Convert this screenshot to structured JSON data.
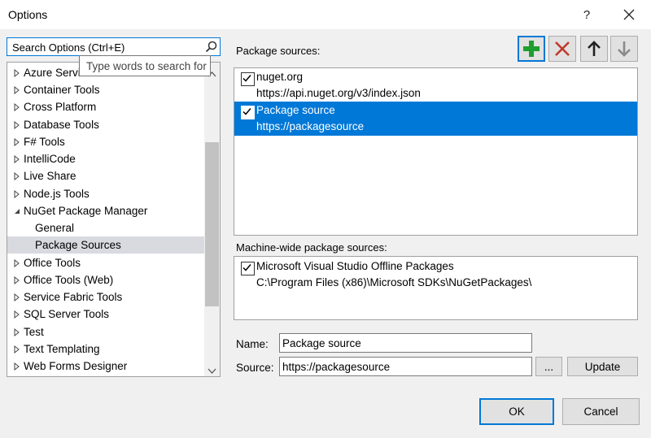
{
  "window": {
    "title": "Options",
    "help": "?",
    "close": "✕"
  },
  "search": {
    "value": "Search Options (Ctrl+E)",
    "tooltip": "Type words to search for"
  },
  "tree": {
    "items": [
      {
        "label": "Azure Servi"
      },
      {
        "label": "Container Tools"
      },
      {
        "label": "Cross Platform"
      },
      {
        "label": "Database Tools"
      },
      {
        "label": "F# Tools"
      },
      {
        "label": "IntelliCode"
      },
      {
        "label": "Live Share"
      },
      {
        "label": "Node.js Tools"
      },
      {
        "label": "NuGet Package Manager"
      },
      {
        "label": "General"
      },
      {
        "label": "Package Sources"
      },
      {
        "label": "Office Tools"
      },
      {
        "label": "Office Tools (Web)"
      },
      {
        "label": "Service Fabric Tools"
      },
      {
        "label": "SQL Server Tools"
      },
      {
        "label": "Test"
      },
      {
        "label": "Text Templating"
      },
      {
        "label": "Web Forms Designer"
      }
    ]
  },
  "package_sources": {
    "label": "Package sources:",
    "entries": [
      {
        "name": "nuget.org",
        "url": "https://api.nuget.org/v3/index.json",
        "checked": true
      },
      {
        "name": "Package source",
        "url": "https://packagesource",
        "checked": true
      }
    ]
  },
  "machine_wide": {
    "label": "Machine-wide package sources:",
    "entries": [
      {
        "name": "Microsoft Visual Studio Offline Packages",
        "path": "C:\\Program Files (x86)\\Microsoft SDKs\\NuGetPackages\\",
        "checked": true
      }
    ]
  },
  "form": {
    "name_label": "Name:",
    "name_value": "Package source",
    "source_label": "Source:",
    "source_value": "https://packagesource",
    "browse_label": "...",
    "update_label": "Update"
  },
  "footer": {
    "ok_label": "OK",
    "cancel_label": "Cancel"
  },
  "colors": {
    "accent": "#0078d7",
    "add_green": "#1e9e2f",
    "remove_red": "#c0392b"
  }
}
